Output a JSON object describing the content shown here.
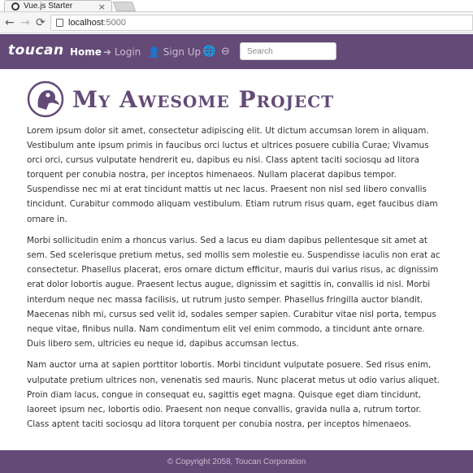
{
  "browser": {
    "tab_title": "Vue.js Starter",
    "tab_close": "×",
    "url_host": "localhost",
    "url_port": ":5000"
  },
  "navbar": {
    "brand": "toucan",
    "home": "Home",
    "login": "Login",
    "signup": "Sign Up",
    "search_placeholder": "Search",
    "login_icon": "sign-in-icon",
    "signup_icon": "user-plus-icon",
    "globe_icon": "globe-icon",
    "zoom_icon": "search-minus-icon"
  },
  "main": {
    "title": "My Awesome Project",
    "paragraphs": [
      "Lorem ipsum dolor sit amet, consectetur adipiscing elit. Ut dictum accumsan lorem in aliquam. Vestibulum ante ipsum primis in faucibus orci luctus et ultrices posuere cubilia Curae; Vivamus orci orci, cursus vulputate hendrerit eu, dapibus eu nisi. Class aptent taciti sociosqu ad litora torquent per conubia nostra, per inceptos himenaeos. Nullam placerat dapibus tempor. Suspendisse nec mi at erat tincidunt mattis ut nec lacus. Praesent non nisl sed libero convallis tincidunt. Curabitur commodo aliquam vestibulum. Etiam rutrum risus quam, eget faucibus diam ornare in.",
      "Morbi sollicitudin enim a rhoncus varius. Sed a lacus eu diam dapibus pellentesque sit amet at sem. Sed scelerisque pretium metus, sed mollis sem molestie eu. Suspendisse iaculis non erat ac consectetur. Phasellus placerat, eros ornare dictum efficitur, mauris dui varius risus, ac dignissim erat dolor lobortis augue. Praesent lectus augue, dignissim et sagittis in, convallis id nisl. Morbi interdum neque nec massa facilisis, ut rutrum justo semper. Phasellus fringilla auctor blandit. Maecenas nibh mi, cursus sed velit id, sodales semper sapien. Curabitur vitae nisl porta, tempus neque vitae, finibus nulla. Nam condimentum elit vel enim commodo, a tincidunt ante ornare. Duis libero sem, ultricies eu neque id, dapibus accumsan lectus.",
      "Nam auctor urna at sapien porttitor lobortis. Morbi tincidunt vulputate posuere. Sed risus enim, vulputate pretium ultrices non, venenatis sed mauris. Nunc placerat metus ut odio varius aliquet. Proin diam lacus, congue in consequat eu, sagittis eget magna. Quisque eget diam tincidunt, laoreet ipsum nec, lobortis odio. Praesent non neque convallis, gravida nulla a, rutrum tortor. Class aptent taciti sociosqu ad litora torquent per conubia nostra, per inceptos himenaeos."
    ]
  },
  "footer": {
    "copyright": "© Copyright 2058, Toucan Corporation"
  },
  "colors": {
    "brand": "#634a77",
    "nav_text": "#c9bcd3"
  }
}
